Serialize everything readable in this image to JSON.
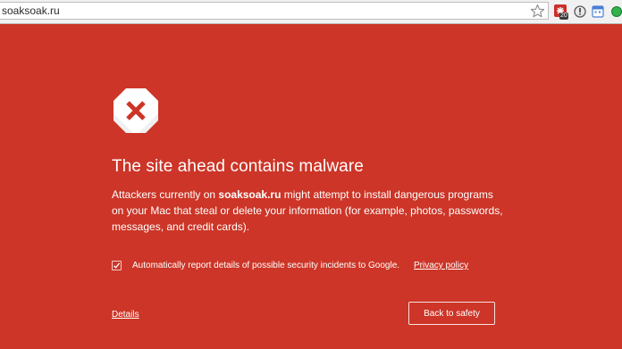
{
  "browser": {
    "url": "soaksoak.ru",
    "extensions": [
      {
        "icon": "red-extension-icon",
        "badge": "20"
      },
      {
        "icon": "info-icon"
      },
      {
        "icon": "calendar-icon"
      },
      {
        "icon": "green-status-icon"
      }
    ]
  },
  "interstitial": {
    "background": "#cc3527",
    "icon": "malware-warning-icon",
    "heading": "The site ahead contains malware",
    "body_prefix": "Attackers currently on ",
    "site": "soaksoak.ru",
    "body_suffix": " might attempt to install dangerous programs on your Mac that steal or delete your information (for example, photos, passwords, messages, and credit cards).",
    "report_checkbox_checked": true,
    "report_label": "Automatically report details of possible security incidents to Google.",
    "privacy_link": "Privacy policy",
    "details_link": "Details",
    "back_button": "Back to safety"
  }
}
